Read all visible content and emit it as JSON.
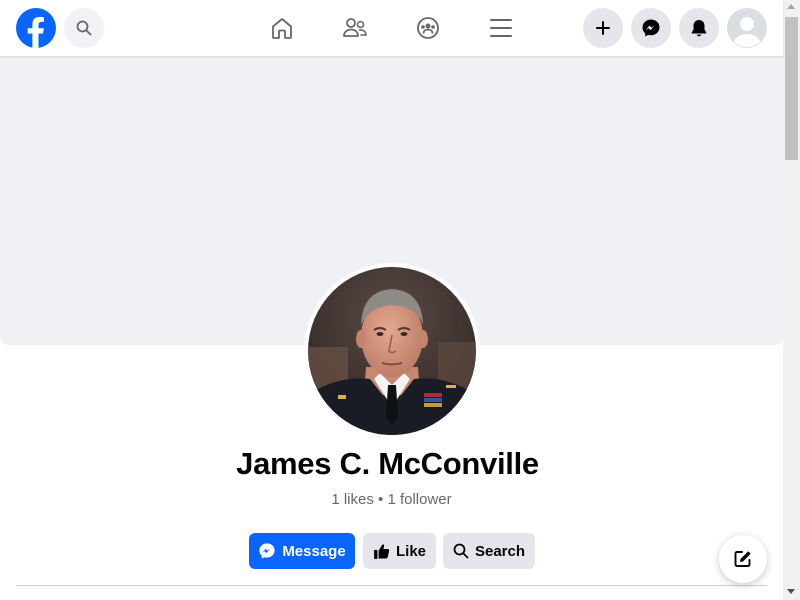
{
  "profile": {
    "name": "James C. McConville",
    "stats": "1 likes • 1 follower"
  },
  "actions": {
    "message_label": "Message",
    "like_label": "Like",
    "search_label": "Search"
  },
  "icons": {
    "logo": "facebook-logo",
    "search": "search-icon",
    "home": "home-icon",
    "friends": "friends-icon",
    "groups": "groups-icon",
    "menu": "menu-icon",
    "create": "plus-icon",
    "messenger": "messenger-icon",
    "notifications": "bell-icon",
    "account": "avatar-icon",
    "compose": "compose-icon"
  },
  "colors": {
    "brand": "#0866ff",
    "button_gray": "#e4e6eb",
    "cover": "#f0f1f5",
    "secondary_text": "#65676b"
  }
}
